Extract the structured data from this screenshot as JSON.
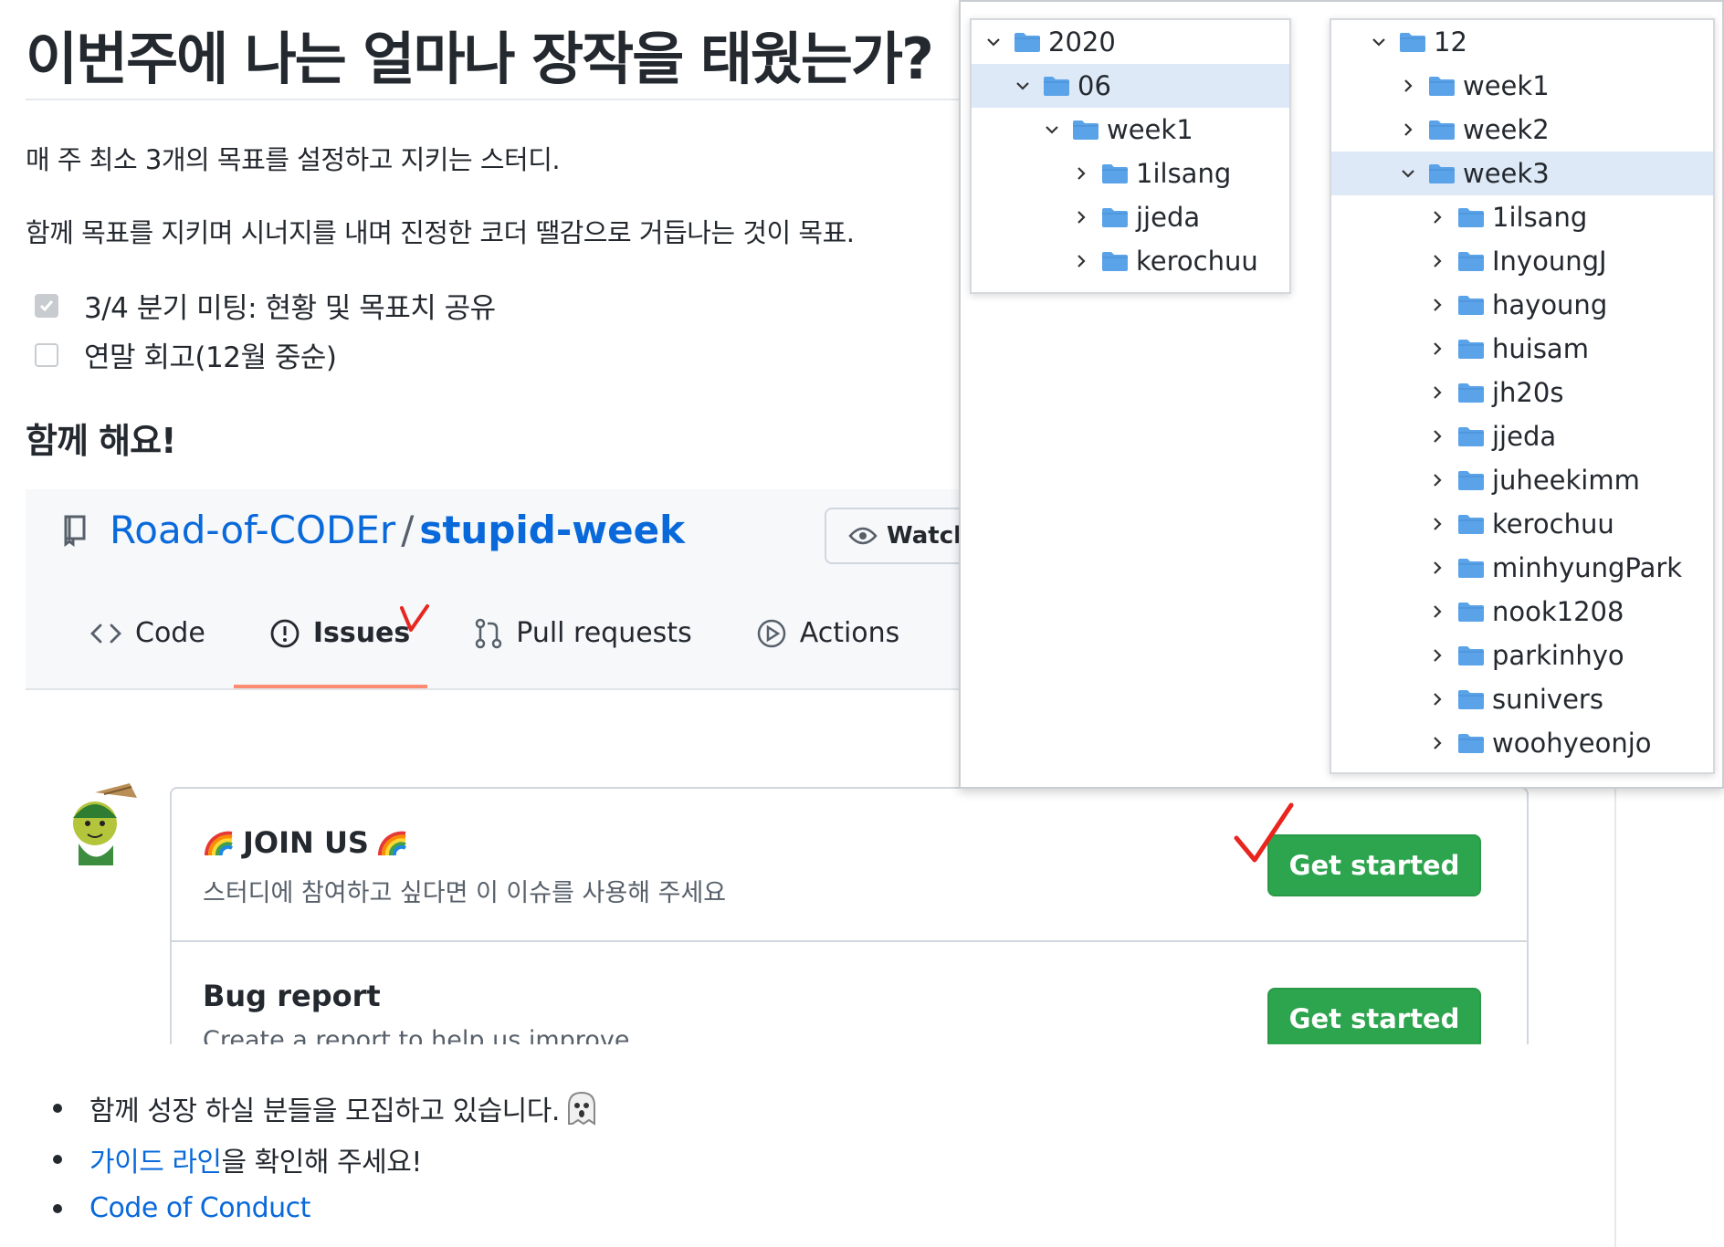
{
  "readme": {
    "title": "이번주에 나는 얼마나 장작을 태웠는가?",
    "intro1": "매 주 최소 3개의 목표를 설정하고 지키는 스터디.",
    "intro2": "함께 목표를 지키며 시너지를 내며 진정한 코더 땔감으로 거듭나는 것이 목표.",
    "tasks": [
      {
        "label": "3/4 분기 미팅: 현황 및 목표치 공유",
        "checked": true
      },
      {
        "label": "연말 회고(12월 중순)",
        "checked": false
      }
    ],
    "subheading": "함께 해요!",
    "bullets": {
      "b1": "함께 성장 하실 분들을 모집하고 있습니다.",
      "b2_link": "가이드 라인",
      "b2_rest": "을 확인해 주세요!",
      "b3_link": "Code of Conduct"
    }
  },
  "repo": {
    "owner": "Road-of-CODEr",
    "separator": "/",
    "name": "stupid-week",
    "watch_label": "Watch",
    "tabs": {
      "code": "Code",
      "issues": "Issues",
      "pulls": "Pull requests",
      "actions": "Actions"
    },
    "templates": [
      {
        "title": "JOIN US",
        "desc": "스터디에 참여하고 싶다면 이 이슈를 사용해 주세요",
        "button": "Get started"
      },
      {
        "title": "Bug report",
        "desc": "Create a report to help us improve",
        "button": "Get started"
      }
    ]
  },
  "tree_left": {
    "rows": [
      {
        "label": "2020",
        "expanded": true,
        "selected": false
      },
      {
        "label": "06",
        "expanded": true,
        "selected": true
      },
      {
        "label": "week1",
        "expanded": true,
        "selected": false
      },
      {
        "label": "1ilsang",
        "expanded": false,
        "selected": false
      },
      {
        "label": "jjeda",
        "expanded": false,
        "selected": false
      },
      {
        "label": "kerochuu",
        "expanded": false,
        "selected": false
      }
    ]
  },
  "tree_right": {
    "rows": [
      {
        "label": "12",
        "expanded": true,
        "selected": false
      },
      {
        "label": "week1",
        "expanded": false,
        "selected": false
      },
      {
        "label": "week2",
        "expanded": false,
        "selected": false
      },
      {
        "label": "week3",
        "expanded": true,
        "selected": true
      },
      {
        "label": "1ilsang",
        "expanded": false,
        "selected": false
      },
      {
        "label": "InyoungJ",
        "expanded": false,
        "selected": false
      },
      {
        "label": "hayoung",
        "expanded": false,
        "selected": false
      },
      {
        "label": "huisam",
        "expanded": false,
        "selected": false
      },
      {
        "label": "jh20s",
        "expanded": false,
        "selected": false
      },
      {
        "label": "jjeda",
        "expanded": false,
        "selected": false
      },
      {
        "label": "juheekimm",
        "expanded": false,
        "selected": false
      },
      {
        "label": "kerochuu",
        "expanded": false,
        "selected": false
      },
      {
        "label": "minhyungPark",
        "expanded": false,
        "selected": false
      },
      {
        "label": "nook1208",
        "expanded": false,
        "selected": false
      },
      {
        "label": "parkinhyo",
        "expanded": false,
        "selected": false
      },
      {
        "label": "sunivers",
        "expanded": false,
        "selected": false
      },
      {
        "label": "woohyeonjo",
        "expanded": false,
        "selected": false
      }
    ]
  },
  "colors": {
    "link": "#0969da",
    "button_green": "#2da44e",
    "folder_blue": "#5ba3e8",
    "selection": "#dde9f7",
    "tab_underline": "#fd8c73",
    "annotation_red": "#e8251f"
  },
  "icons": [
    "repo-icon",
    "eye-icon",
    "code-icon",
    "issue-icon",
    "pull-request-icon",
    "play-icon",
    "project-icon",
    "folder-icon",
    "chevron-icon",
    "rainbow-icon",
    "ghost-icon",
    "checkmark-icon"
  ]
}
